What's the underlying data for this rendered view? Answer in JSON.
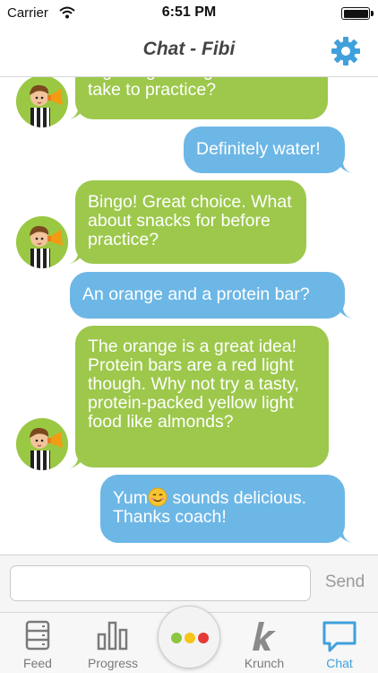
{
  "status_bar": {
    "carrier": "Carrier",
    "time": "6:51 PM",
    "battery_level": 1.0
  },
  "header": {
    "title": "Chat - Fibi"
  },
  "messages": [
    {
      "sender": "coach",
      "text": "a good green light drink to take to practice?"
    },
    {
      "sender": "user",
      "text": "Definitely water!"
    },
    {
      "sender": "coach",
      "text": "Bingo! Great choice. What about snacks for before practice?"
    },
    {
      "sender": "user",
      "text": "An orange and a protein bar?"
    },
    {
      "sender": "coach",
      "text": "The orange is a great idea! Protein bars are a red light though. Why not try a tasty, protein-packed yellow light food like almonds?"
    },
    {
      "sender": "user",
      "text_before_emoji": "Yum",
      "text_after_emoji": " sounds delicious. Thanks coach!"
    }
  ],
  "composer": {
    "value": "",
    "placeholder": "",
    "send_label": "Send"
  },
  "tabs": [
    {
      "label": "Feed",
      "icon": "feed-icon"
    },
    {
      "label": "Progress",
      "icon": "bar-chart-icon"
    },
    {
      "label": "",
      "icon": "traffic-light-dots-icon"
    },
    {
      "label": "Krunch",
      "icon": "krunch-k-icon"
    },
    {
      "label": "Chat",
      "icon": "chat-bubble-icon",
      "active": true
    }
  ],
  "colors": {
    "coach_bubble": "#9dc84c",
    "user_bubble": "#6db7e6",
    "accent": "#3fa0dc",
    "dot_green": "#8cc63f",
    "dot_yellow": "#f5c518",
    "dot_red": "#e53935"
  }
}
